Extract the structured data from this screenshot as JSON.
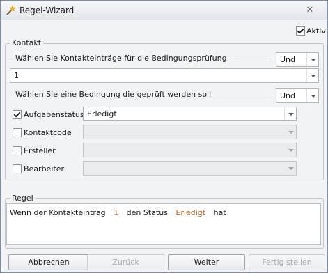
{
  "window": {
    "title": "Regel-Wizard",
    "close_glyph": "✕",
    "icon": "wizard-wand-icon"
  },
  "aktiv": {
    "label": "Aktiv",
    "checked": true
  },
  "kontakt": {
    "legend": "Kontakt",
    "selection": {
      "label": "Wählen Sie Kontakteinträge für die Bedingungsprüfung",
      "operator": "Und",
      "value": "1"
    },
    "condition": {
      "label": "Wählen Sie eine Bedingung die geprüft werden soll",
      "operator": "Und",
      "rows": [
        {
          "label": "Aufgabenstatus",
          "checked": true,
          "value": "Erledigt",
          "enabled": true
        },
        {
          "label": "Kontaktcode",
          "checked": false,
          "value": "",
          "enabled": false
        },
        {
          "label": "Ersteller",
          "checked": false,
          "value": "",
          "enabled": false
        },
        {
          "label": "Bearbeiter",
          "checked": false,
          "value": "",
          "enabled": false
        }
      ]
    }
  },
  "regel": {
    "legend": "Regel",
    "text": {
      "part1": "Wenn der Kontakteintrag",
      "value1": "1",
      "part2": "den Status",
      "value2": "Erledigt",
      "part3": "hat"
    },
    "highlight_color": "#c0641b"
  },
  "buttons": {
    "cancel": "Abbrechen",
    "back": "Zurück",
    "next": "Weiter",
    "finish": "Fertig stellen"
  }
}
